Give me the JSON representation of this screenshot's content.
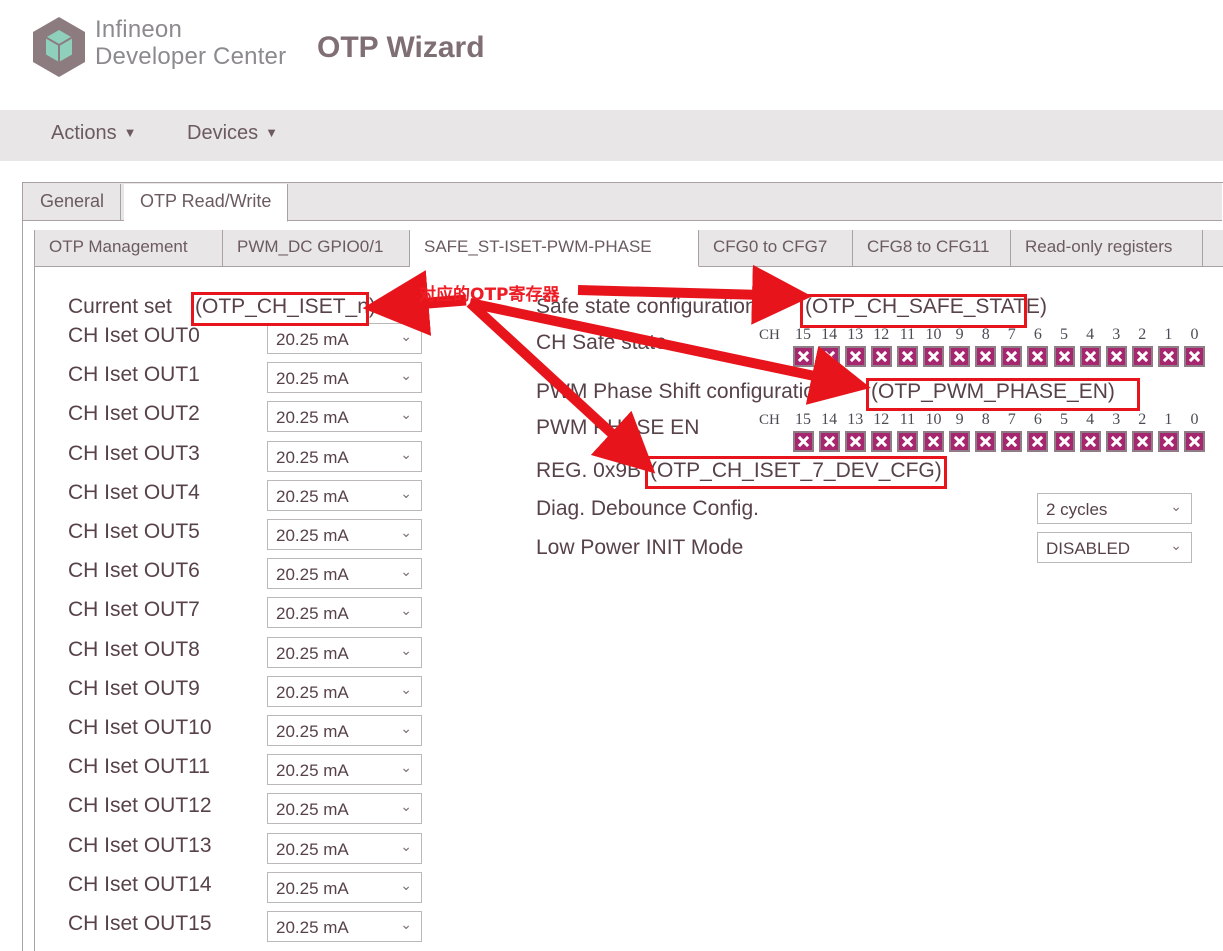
{
  "brand": {
    "line1": "Infineon",
    "line2": "Developer Center",
    "app_title": "OTP Wizard",
    "logo_icon": "infineon-hex-cube-icon",
    "hex_color": "#8c7c80",
    "cube_color": "#8fd0bc"
  },
  "menubar": {
    "items": [
      {
        "label": "Actions",
        "caret": "▼"
      },
      {
        "label": "Devices",
        "caret": "▼"
      }
    ]
  },
  "outer_tabs": [
    {
      "label": "General",
      "active": false
    },
    {
      "label": "OTP Read/Write",
      "active": true
    }
  ],
  "inner_tabs": [
    {
      "label": "OTP Management",
      "active": false
    },
    {
      "label": "PWM_DC GPIO0/1",
      "active": false
    },
    {
      "label": "SAFE_ST-ISET-PWM-PHASE",
      "active": true
    },
    {
      "label": "CFG0 to CFG7",
      "active": false
    },
    {
      "label": "CFG8 to CFG11",
      "active": false
    },
    {
      "label": "Read-only registers",
      "active": false
    },
    {
      "label": "",
      "active": false
    }
  ],
  "left_panel": {
    "heading_prefix": "Current set",
    "heading_register": "(OTP_CH_ISET_n)",
    "rows": [
      {
        "label": "CH Iset OUT0",
        "value": "20.25 mA"
      },
      {
        "label": "CH Iset OUT1",
        "value": "20.25 mA"
      },
      {
        "label": "CH Iset OUT2",
        "value": "20.25 mA"
      },
      {
        "label": "CH Iset OUT3",
        "value": "20.25 mA"
      },
      {
        "label": "CH Iset OUT4",
        "value": "20.25 mA"
      },
      {
        "label": "CH Iset OUT5",
        "value": "20.25 mA"
      },
      {
        "label": "CH Iset OUT6",
        "value": "20.25 mA"
      },
      {
        "label": "CH Iset OUT7",
        "value": "20.25 mA"
      },
      {
        "label": "CH Iset OUT8",
        "value": "20.25 mA"
      },
      {
        "label": "CH Iset OUT9",
        "value": "20.25 mA"
      },
      {
        "label": "CH Iset OUT10",
        "value": "20.25 mA"
      },
      {
        "label": "CH Iset OUT11",
        "value": "20.25 mA"
      },
      {
        "label": "CH Iset OUT12",
        "value": "20.25 mA"
      },
      {
        "label": "CH Iset OUT13",
        "value": "20.25 mA"
      },
      {
        "label": "CH Iset OUT14",
        "value": "20.25 mA"
      },
      {
        "label": "CH Iset OUT15",
        "value": "20.25 mA"
      }
    ],
    "chevron": "⌄"
  },
  "right_panel": {
    "safe_state": {
      "heading_prefix": "Safe state configuration",
      "heading_register": "(OTP_CH_SAFE_STATE)",
      "row_label": "CH Safe state",
      "ch_label": "CH",
      "bit_labels": [
        "15",
        "14",
        "13",
        "12",
        "11",
        "10",
        "9",
        "8",
        "7",
        "6",
        "5",
        "4",
        "3",
        "2",
        "1",
        "0"
      ],
      "bit_states": [
        true,
        true,
        true,
        true,
        true,
        true,
        true,
        true,
        true,
        true,
        true,
        true,
        true,
        true,
        true,
        true
      ],
      "checkbox_fill": "#a6276f",
      "checkbox_border": "#8f7d86"
    },
    "pwm_phase": {
      "heading_prefix": "PWM Phase Shift configuration",
      "heading_register": "(OTP_PWM_PHASE_EN)",
      "row_label": "PWM PHASE EN",
      "ch_label": "CH",
      "bit_labels": [
        "15",
        "14",
        "13",
        "12",
        "11",
        "10",
        "9",
        "8",
        "7",
        "6",
        "5",
        "4",
        "3",
        "2",
        "1",
        "0"
      ],
      "bit_states": [
        true,
        true,
        true,
        true,
        true,
        true,
        true,
        true,
        true,
        true,
        true,
        true,
        true,
        true,
        true,
        true
      ]
    },
    "reg": {
      "heading_prefix": "REG. 0x9B",
      "heading_register": "(OTP_CH_ISET_7_DEV_CFG)",
      "rows": [
        {
          "label": "Diag. Debounce Config.",
          "value": "2 cycles"
        },
        {
          "label": "Low Power INIT Mode",
          "value": "DISABLED"
        }
      ],
      "chevron": "⌄"
    }
  },
  "annotations": {
    "color": "#e8141c",
    "cn_note": "对应的OTP寄存器",
    "boxes": [
      {
        "name": "iset-register-box"
      },
      {
        "name": "safe-state-register-box"
      },
      {
        "name": "pwm-phase-register-box"
      },
      {
        "name": "dev-cfg-register-box"
      }
    ]
  }
}
